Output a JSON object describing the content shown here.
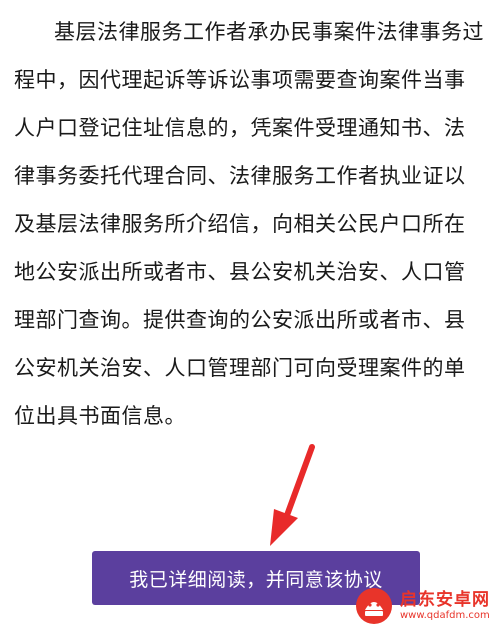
{
  "agreement": {
    "text": "基层法律服务工作者承办民事案件法律事务过程中，因代理起诉等诉讼事项需要查询案件当事人户口登记住址信息的，凭案件受理通知书、法律事务委托代理合同、法律服务工作者执业证以及基层法律服务所介绍信，向相关公民户口所在地公安派出所或者市、县公安机关治安、人口管理部门查询。提供查询的公安派出所或者市、县公安机关治安、人口管理部门可向受理案件的单位出具书面信息。"
  },
  "button": {
    "label": "我已详细阅读，并同意该协议"
  },
  "watermark": {
    "name": "启东安卓网",
    "url": "www.qdafdm.com"
  },
  "colors": {
    "button_bg": "#5b3f9e",
    "arrow": "#e82a2a",
    "watermark": "#e8342a"
  }
}
